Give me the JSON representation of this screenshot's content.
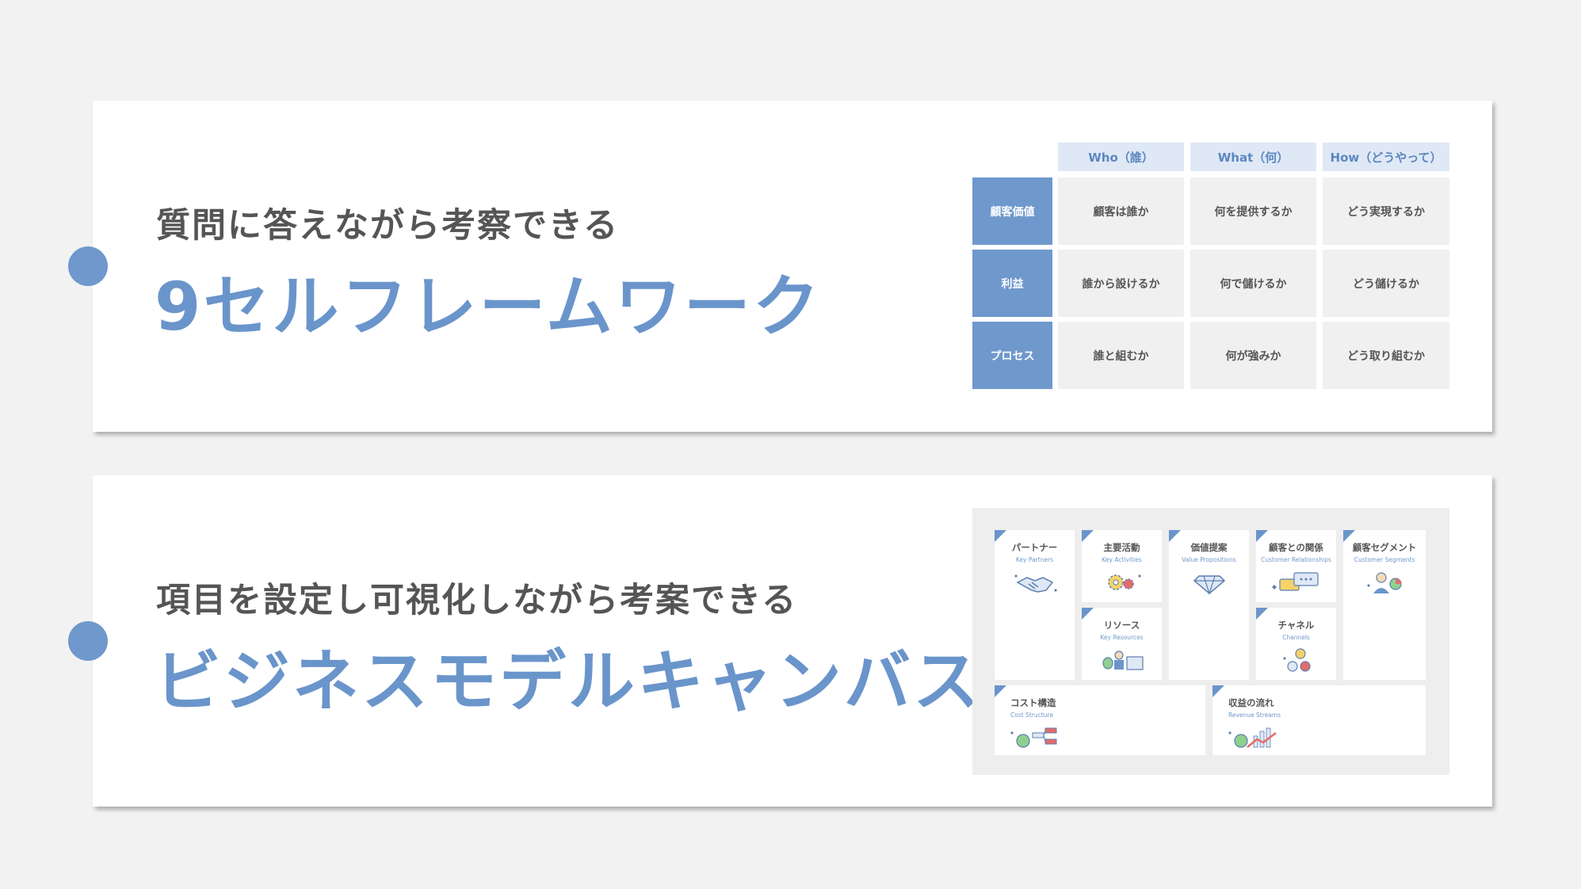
{
  "section1": {
    "subtitle": "質問に答えながら考察できる",
    "title": "9セルフレームワーク",
    "grid": {
      "columns": [
        "Who（誰）",
        "What（何）",
        "How（どうやって）"
      ],
      "rows": [
        {
          "label": "顧客価値",
          "cells": [
            "顧客は誰か",
            "何を提供するか",
            "どう実現するか"
          ]
        },
        {
          "label": "利益",
          "cells": [
            "誰から設けるか",
            "何で儲けるか",
            "どう儲けるか"
          ]
        },
        {
          "label": "プロセス",
          "cells": [
            "誰と組むか",
            "何が強みか",
            "どう取り組むか"
          ]
        }
      ]
    }
  },
  "section2": {
    "subtitle": "項目を設定し可視化しながら考案できる",
    "title": "ビジネスモデルキャンバス",
    "canvas": {
      "partners": {
        "jp": "パートナー",
        "en": "Key Partners",
        "icon": "handshake-icon"
      },
      "activities": {
        "jp": "主要活動",
        "en": "Key Activities",
        "icon": "gears-icon"
      },
      "resources": {
        "jp": "リソース",
        "en": "Key Resources",
        "icon": "resources-icon"
      },
      "value": {
        "jp": "価値提案",
        "en": "Value Propositions",
        "icon": "diamond-icon"
      },
      "relationships": {
        "jp": "顧客との関係",
        "en": "Customer Relationships",
        "icon": "chat-icon"
      },
      "channels": {
        "jp": "チャネル",
        "en": "Channels",
        "icon": "channels-icon"
      },
      "segments": {
        "jp": "顧客セグメント",
        "en": "Customer Segments",
        "icon": "people-icon"
      },
      "cost": {
        "jp": "コスト構造",
        "en": "Cost Structure",
        "icon": "money-bag-icon"
      },
      "revenue": {
        "jp": "収益の流れ",
        "en": "Revenue Streams",
        "icon": "growth-chart-icon"
      }
    }
  },
  "colors": {
    "accent": "#6a95cb",
    "header_bg": "#dfe8f5",
    "cell_bg": "#f0f0f0"
  }
}
